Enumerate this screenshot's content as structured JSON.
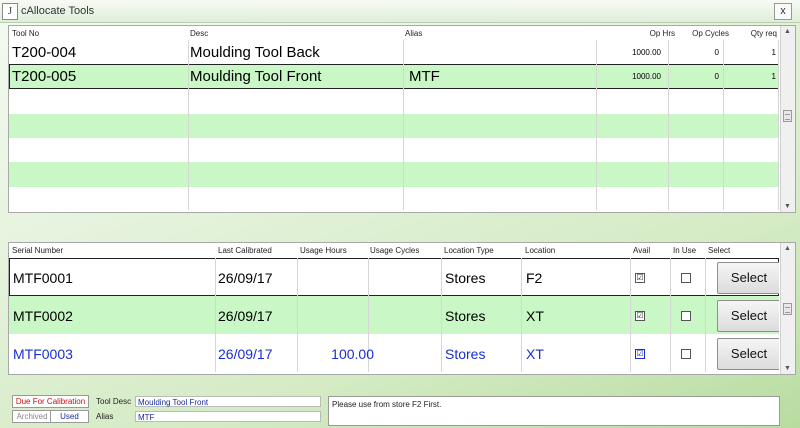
{
  "window": {
    "title": "cAllocate Tools",
    "icon_glyph": "J",
    "close_glyph": "x"
  },
  "tools_grid": {
    "headers": [
      "Tool No",
      "Desc",
      "Alias",
      "Op Hrs",
      "Op Cycles",
      "Qty req"
    ],
    "rows": [
      {
        "tool_no": "T200-004",
        "desc": "Moulding Tool Back",
        "alias": "",
        "op_hrs": "1000.00",
        "op_cycles": "0",
        "qty_req": "1"
      },
      {
        "tool_no": "T200-005",
        "desc": "Moulding Tool Front",
        "alias": "MTF",
        "op_hrs": "1000.00",
        "op_cycles": "0",
        "qty_req": "1"
      }
    ]
  },
  "serials_grid": {
    "headers": [
      "Serial Number",
      "Last Calibrated",
      "Usage Hours",
      "Usage Cycles",
      "Location Type",
      "Location",
      "Avail",
      "In Use",
      "Select"
    ],
    "rows": [
      {
        "serial": "MTF0001",
        "last_cal": "26/09/17",
        "usage_hours": "",
        "location_type": "Stores",
        "location": "F2",
        "avail": "☑",
        "in_use": "",
        "select_label": "Select"
      },
      {
        "serial": "MTF0002",
        "last_cal": "26/09/17",
        "usage_hours": "",
        "location_type": "Stores",
        "location": "XT",
        "avail": "☑",
        "in_use": "",
        "select_label": "Select"
      },
      {
        "serial": "MTF0003",
        "last_cal": "26/09/17",
        "usage_hours": "100.00",
        "location_type": "Stores",
        "location": "XT",
        "avail": "☑",
        "in_use": "",
        "select_label": "Select"
      }
    ]
  },
  "legend": {
    "due": "Due For Calibration",
    "archived": "Archived",
    "used": "Used"
  },
  "details": {
    "tool_desc_label": "Tool Desc",
    "tool_desc_value": "Moulding Tool Front",
    "alias_label": "Alias",
    "alias_value": "MTF",
    "note": "Please use from store F2 First."
  },
  "colors": {
    "row_green": "#c9f7c5",
    "highlight_text": "#1a2fd0",
    "due_red": "#c01010",
    "link_blue": "#1a2a9a"
  },
  "icons": {
    "scroll_up": "▲",
    "scroll_down": "▼"
  }
}
